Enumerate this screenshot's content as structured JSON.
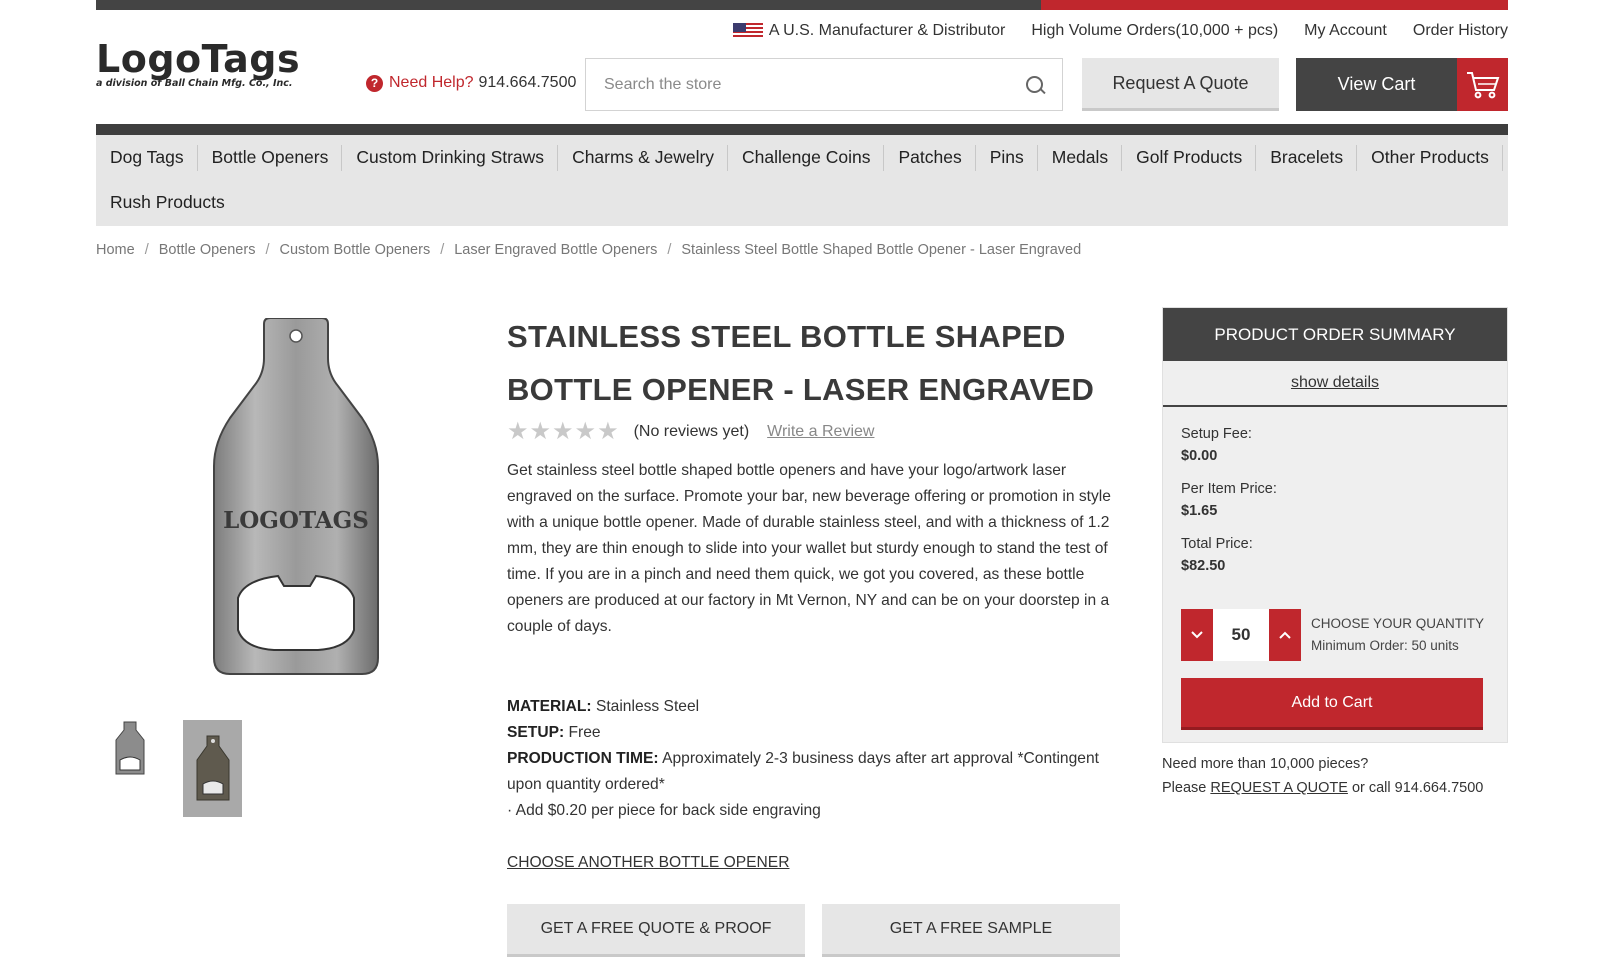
{
  "colors": {
    "brand_red": "#c0272d",
    "dark_gray": "#444444",
    "light_gray": "#e6e6e6"
  },
  "header": {
    "logo_text": "LogoTags",
    "logo_subtext": "a division of Ball Chain Mfg. Co., Inc.",
    "help_label": "Need Help?",
    "help_phone": "914.664.7500",
    "top_links": {
      "manufacturer": "A U.S. Manufacturer & Distributor",
      "high_volume": "High Volume Orders(10,000 + pcs)",
      "my_account": "My Account",
      "order_history": "Order History"
    },
    "search_placeholder": "Search the store",
    "quote_label": "Request A Quote",
    "cart_label": "View Cart"
  },
  "nav": {
    "items": [
      "Dog Tags",
      "Bottle Openers",
      "Custom Drinking Straws",
      "Charms & Jewelry",
      "Challenge Coins",
      "Patches",
      "Pins",
      "Medals",
      "Golf Products",
      "Bracelets",
      "Other Products",
      "Rush Products"
    ]
  },
  "breadcrumb": [
    "Home",
    "Bottle Openers",
    "Custom Bottle Openers",
    "Laser Engraved Bottle Openers",
    "Stainless Steel Bottle Shaped Bottle Opener - Laser Engraved"
  ],
  "product": {
    "image_engraving": "LOGOTAGS",
    "title": "STAINLESS STEEL BOTTLE SHAPED BOTTLE OPENER - LASER ENGRAVED",
    "rating_stars": 0,
    "reviews_text": "(No reviews yet)",
    "write_review": "Write a Review",
    "description": "Get stainless steel bottle shaped bottle openers and have your logo/artwork laser engraved on the surface. Promote your bar, new beverage offering or promotion in style with a unique bottle opener.  Made of durable stainless steel, and with a thickness of 1.2 mm, they are thin enough to slide into your wallet but sturdy enough to stand the test of time. If you are in a pinch and need them quick, we got you covered, as these bottle openers are produced at our factory in Mt Vernon, NY and can be on your doorstep in a couple of days.",
    "material_label": "MATERIAL:",
    "material_value": "Stainless Steel",
    "setup_label": "SETUP:",
    "setup_value": "Free",
    "production_label": "PRODUCTION TIME:",
    "production_value": "Approximately 2-3 business days after art approval *Contingent upon quantity ordered*",
    "back_side_note": "· Add $0.20 per piece for back side engraving",
    "choose_another": "CHOOSE ANOTHER BOTTLE OPENER",
    "free_quote_button": "GET A FREE QUOTE & PROOF",
    "free_sample_button": "GET A FREE SAMPLE"
  },
  "summary": {
    "header": "PRODUCT ORDER SUMMARY",
    "show_details": "show details",
    "setup_fee_label": "Setup Fee:",
    "setup_fee_value": "$0.00",
    "per_item_label": "Per Item Price:",
    "per_item_value": "$1.65",
    "total_label": "Total Price:",
    "total_value": "$82.50",
    "quantity": "50",
    "choose_quantity": "CHOOSE YOUR QUANTITY",
    "minimum_order": "Minimum Order: 50 units",
    "add_to_cart": "Add to Cart"
  },
  "more_info": {
    "line1": "Need more than 10,000 pieces?",
    "please": "Please",
    "request_quote": "REQUEST A QUOTE",
    "or_call": "or call 914.664.7500"
  }
}
